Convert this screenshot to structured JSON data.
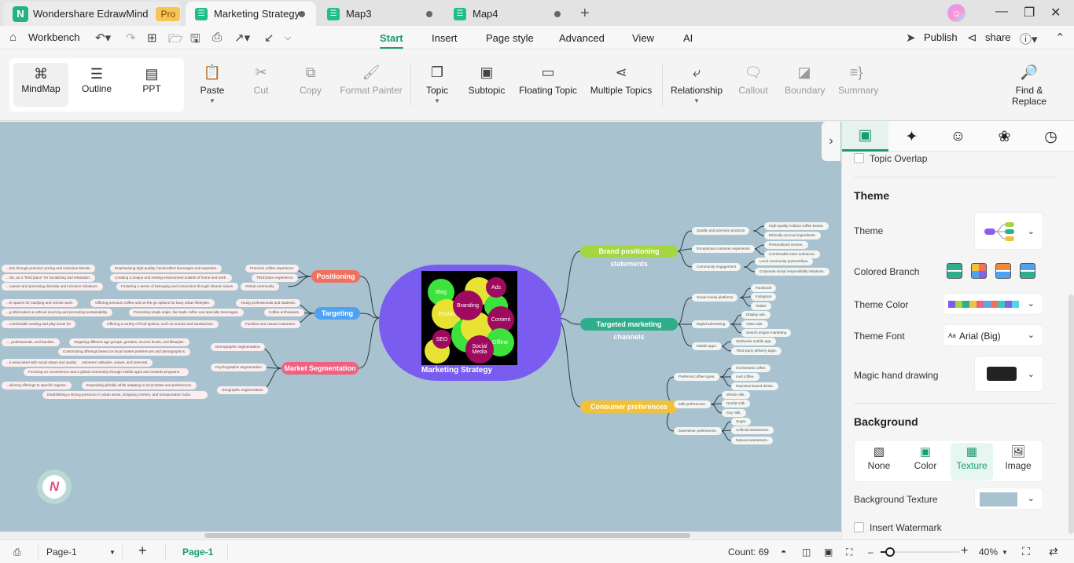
{
  "titlebar": {
    "app_name": "Wondershare EdrawMind",
    "pro_badge": "Pro",
    "tabs": [
      {
        "label": "Marketing Strategy",
        "active": true,
        "unsaved": true
      },
      {
        "label": "Map3",
        "active": false,
        "unsaved": true
      },
      {
        "label": "Map4",
        "active": false,
        "unsaved": true
      }
    ]
  },
  "menubar": {
    "workbench": "Workbench",
    "tabs": [
      "Start",
      "Insert",
      "Page style",
      "Advanced",
      "View",
      "AI"
    ],
    "active_tab": "Start",
    "publish": "Publish",
    "share": "share"
  },
  "ribbon": {
    "views": [
      {
        "label": "MindMap",
        "icon": "mindmap-icon",
        "selected": true
      },
      {
        "label": "Outline",
        "icon": "outline-icon",
        "selected": false
      },
      {
        "label": "PPT",
        "icon": "ppt-icon",
        "selected": false
      }
    ],
    "paste": "Paste",
    "cut": "Cut",
    "copy": "Copy",
    "format_painter": "Format Painter",
    "topic": "Topic",
    "subtopic": "Subtopic",
    "floating_topic": "Floating Topic",
    "multiple_topics": "Multiple Topics",
    "relationship": "Relationship",
    "callout": "Callout",
    "boundary": "Boundary",
    "summary": "Summary",
    "find_replace": "Find & Replace"
  },
  "mindmap": {
    "central": {
      "label": "Marketing Strategy",
      "bubbles": [
        "Blog",
        "Ads",
        "Branding",
        "Emails",
        "Content",
        "SEO",
        "Offline",
        "Social Media"
      ]
    },
    "right_branches": [
      {
        "label": "Brand positioning statements",
        "color": "#a3d63f",
        "children": [
          {
            "label": "Quality and premium products",
            "leaves": [
              "High-quality Arabica coffee beans.",
              "Ethically sourced ingredients."
            ]
          },
          {
            "label": "Exceptional customer experience",
            "leaves": [
              "Personalized service.",
              "Comfortable store ambiance."
            ]
          },
          {
            "label": "Community engagement",
            "leaves": [
              "Local community partnerships.",
              "Corporate social responsibility initiatives."
            ]
          }
        ]
      },
      {
        "label": "Targeted marketing channels",
        "color": "#2fae8c",
        "children": [
          {
            "label": "Social media platforms",
            "leaves": [
              "Facebook",
              "Instagram",
              "Twitter"
            ]
          },
          {
            "label": "Digital advertising",
            "leaves": [
              "Display ads.",
              "Video ads.",
              "Search engine marketing"
            ]
          },
          {
            "label": "Mobile apps.",
            "leaves": [
              "Starbucks mobile app.",
              "Third-party delivery apps."
            ]
          }
        ]
      },
      {
        "label": "Consumer preferences",
        "color": "#f0c13a",
        "children": [
          {
            "label": "Preferred coffee types.",
            "leaves": [
              "Hot brewed coffee.",
              "Iced coffee.",
              "Espresso-based drinks."
            ]
          },
          {
            "label": "Milk preferences.",
            "leaves": [
              "Whole milk.",
              "Nonfat milk.",
              "Soy milk."
            ]
          },
          {
            "label": "Sweetener preferences.",
            "leaves": [
              "Sugar.",
              "Artificial sweeteners.",
              "Natural sweeteners."
            ]
          }
        ]
      }
    ],
    "left_branches": [
      {
        "label": "Positioning",
        "color": "#f06f5e",
        "children": [
          {
            "label": "Premium coffee experience",
            "detail": "Emphasizing high-quality, handcrafted beverages and expertise.",
            "more": "...tion through premium pricing and exclusive blends."
          },
          {
            "label": "Third-place experience",
            "detail": "Creating a unique and inviting environment outside of home and work.",
            "more": "...cle, as a \"third place\" for socializing and relaxation."
          },
          {
            "label": "Global community",
            "detail": "Fostering a sense of belonging and connection through shared values.",
            "more": "...causes and promoting diversity and inclusion initiatives."
          }
        ]
      },
      {
        "label": "Targeting",
        "color": "#4da3f2",
        "children": [
          {
            "label": "Young professionals and students.",
            "detail": "Offering premium coffee and on-the-go options for busy urban lifestyles.",
            "more": "...le spaces for studying and remote work."
          },
          {
            "label": "Coffee enthusiasts.",
            "detail": "Promoting single-origin, fair-trade coffee and specialty beverages.",
            "more": "...g information on ethical sourcing and promoting sustainability."
          },
          {
            "label": "Families and casual customers.",
            "detail": "Offering a variety of food options, such as snacks and sandwiches.",
            "more": "...comfortable seating and play areas for"
          }
        ]
      },
      {
        "label": "Market Segmentation",
        "color": "#f0607f",
        "children": [
          {
            "label": "Demographic segmentation:",
            "details": [
              "Targeting different age groups, genders, income levels, and lifestyles.",
              "Customizing offerings based on local market preferences and demographics."
            ],
            "more": "..., professionals, and families."
          },
          {
            "label": "Psychographic segmentation",
            "details": [
              "Catering to customers' attitudes, values, and interests.",
              "Focusing on convenience and a global community through mobile apps and rewards programs."
            ],
            "more": "...e associated with social status and quality."
          },
          {
            "label": "Geographic segmentation",
            "details": [
              "Expanding globally while adapting to local tastes and preferences.",
              "Establishing a strong presence in urban areas, shopping centers, and transportation hubs."
            ],
            "more": "...ailoring offerings to specific regions."
          }
        ]
      }
    ]
  },
  "panel": {
    "tabs": [
      "page-format-icon",
      "ai-sparkle-icon",
      "icon-mark-icon",
      "style-icon",
      "history-icon"
    ],
    "topic_overlap": "Topic Overlap",
    "theme_heading": "Theme",
    "theme_label": "Theme",
    "colored_branch_label": "Colored Branch",
    "theme_color_label": "Theme Color",
    "theme_colors": [
      "#7b5cf0",
      "#a3d63f",
      "#2fae8c",
      "#f0c13a",
      "#f0607f",
      "#5aa6f0",
      "#f06f5e",
      "#3cc7b4",
      "#8a5cf0",
      "#4fd8e8"
    ],
    "theme_font_label": "Theme Font",
    "theme_font_value": "Arial (Big)",
    "magic_hand_label": "Magic hand drawing",
    "background_heading": "Background",
    "background_options": [
      {
        "label": "None",
        "selected": false
      },
      {
        "label": "Color",
        "selected": false
      },
      {
        "label": "Texture",
        "selected": true
      },
      {
        "label": "Image",
        "selected": false
      }
    ],
    "background_texture_label": "Background Texture",
    "background_texture_color": "#a8c2d0",
    "insert_watermark": "Insert Watermark"
  },
  "statusbar": {
    "page_select": "Page-1",
    "page_tab": "Page-1",
    "count": "Count: 69",
    "zoom": "40%",
    "zoom_fraction": 0.1
  }
}
